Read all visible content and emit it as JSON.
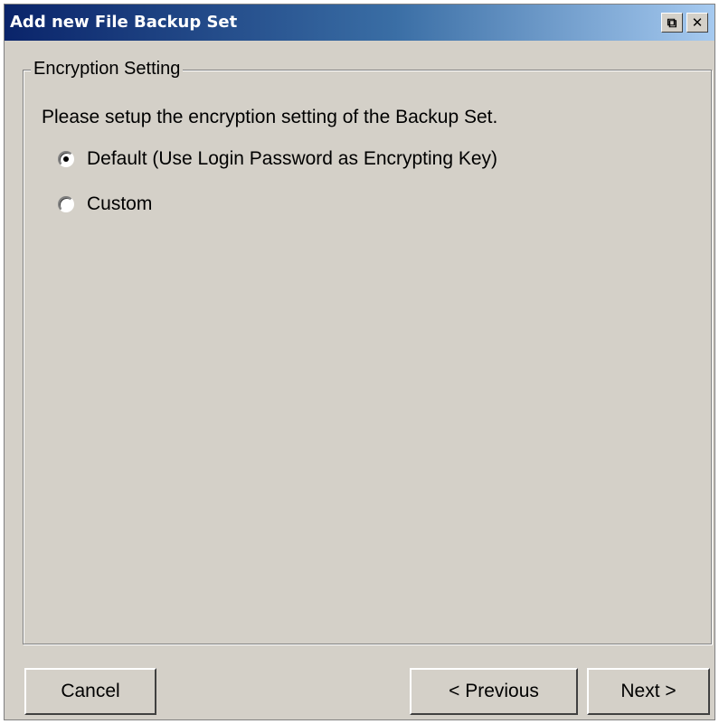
{
  "window": {
    "title": "Add new File Backup Set",
    "restore_icon": "restore-window-icon",
    "close_icon": "close-icon"
  },
  "encryption": {
    "group_label": "Encryption Setting",
    "instruction": "Please setup the encryption setting of the Backup Set.",
    "options": [
      {
        "label": "Default (Use Login Password as Encrypting Key)",
        "checked": true
      },
      {
        "label": "Custom",
        "checked": false
      }
    ]
  },
  "buttons": {
    "cancel": "Cancel",
    "previous": "< Previous",
    "next": "Next >"
  },
  "colors": {
    "title_gradient_start": "#0a246a",
    "title_gradient_end": "#a6caf0",
    "face": "#d4d0c8"
  }
}
